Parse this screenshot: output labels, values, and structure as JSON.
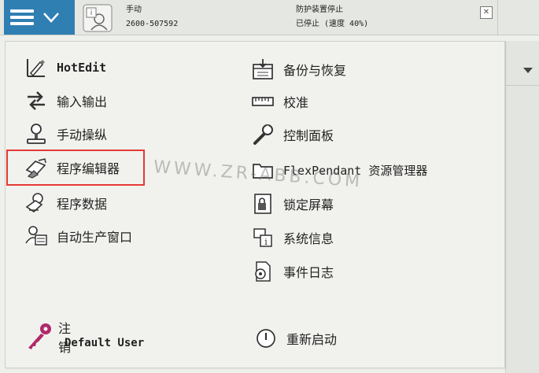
{
  "status": {
    "mode": "手动",
    "controller_id": "2600-507592",
    "state_line1": "防护装置停止",
    "state_line2": "已停止 (速度 40%)"
  },
  "menu": {
    "left": [
      {
        "label": "HotEdit",
        "icon": "hotedit-icon"
      },
      {
        "label": "输入输出",
        "icon": "io-arrows-icon"
      },
      {
        "label": "手动操纵",
        "icon": "jogging-icon"
      },
      {
        "label": "程序编辑器",
        "icon": "program-editor-icon"
      },
      {
        "label": "程序数据",
        "icon": "program-data-icon"
      },
      {
        "label": "自动生产窗口",
        "icon": "production-window-icon"
      }
    ],
    "right": [
      {
        "label": "备份与恢复",
        "icon": "backup-restore-icon"
      },
      {
        "label": "校准",
        "icon": "calibration-icon"
      },
      {
        "label": "控制面板",
        "icon": "wrench-icon"
      },
      {
        "label": "FlexPendant 资源管理器",
        "icon": "folder-icon"
      },
      {
        "label": "锁定屏幕",
        "icon": "lock-screen-icon"
      },
      {
        "label": "系统信息",
        "icon": "system-info-icon"
      },
      {
        "label": "事件日志",
        "icon": "event-log-icon"
      }
    ],
    "logout_label": "注销",
    "user_name": "Default User",
    "restart_label": "重新启动"
  },
  "watermark": "WWW.ZR-ABB.COM",
  "colors": {
    "abb_blue": "#2f7fb3",
    "highlight_red": "#e53935"
  }
}
